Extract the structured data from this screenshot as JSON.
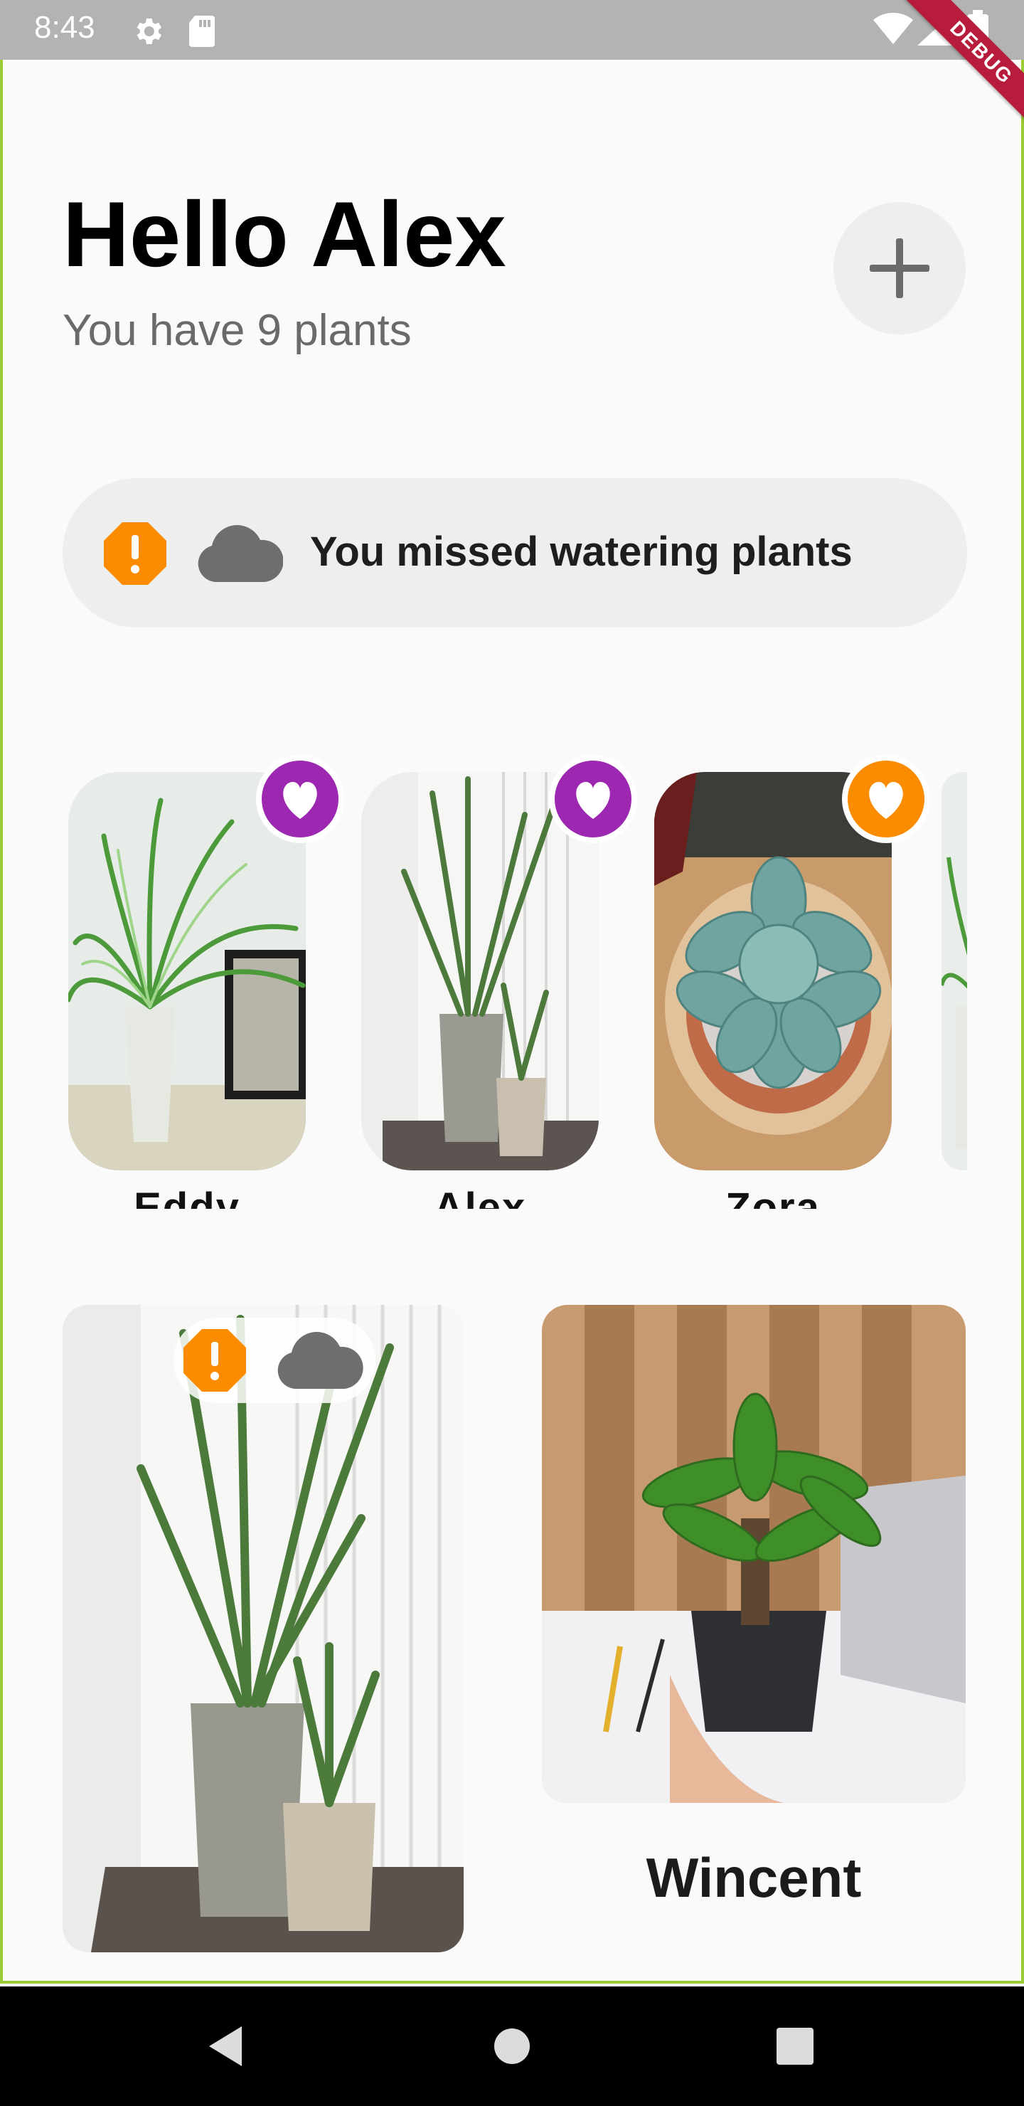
{
  "status_bar": {
    "time": "8:43",
    "icons": [
      "settings-icon",
      "sd-card-icon",
      "wifi-icon",
      "signal-icon",
      "battery-icon"
    ]
  },
  "debug_banner": {
    "label": "DEBUG"
  },
  "header": {
    "greeting": "Hello Alex",
    "subtitle": "You have 9 plants",
    "add_button_icon": "plus-icon"
  },
  "alert": {
    "icon": "warning-icon",
    "weather_icon": "cloud-icon",
    "message": "You missed watering plants",
    "accent": "#fb8c00"
  },
  "favorites": [
    {
      "name": "Eddy",
      "badge_color": "#9c27b0",
      "badge_icon": "heart-icon"
    },
    {
      "name": "Alex",
      "badge_color": "#9c27b0",
      "badge_icon": "heart-icon"
    },
    {
      "name": "Zora",
      "badge_color": "#fb8c00",
      "badge_icon": "heart-icon"
    }
  ],
  "grid": {
    "left_card": {
      "status_icons": [
        "warning-icon",
        "cloud-icon"
      ]
    },
    "right_card": {
      "name": "Wincent"
    }
  },
  "nav_bar": {
    "buttons": [
      "back-icon",
      "home-icon",
      "recents-icon"
    ]
  }
}
